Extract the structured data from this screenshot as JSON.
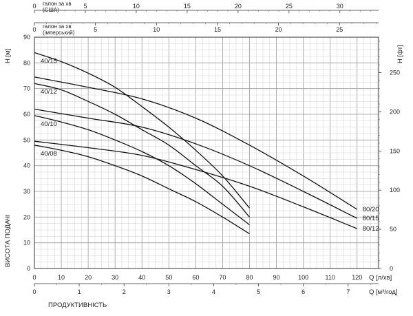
{
  "chart_data": {
    "type": "line",
    "grid": true,
    "axes": {
      "us_gallon": {
        "label": "галон за хв (США)",
        "lim": [
          0,
          33.8
        ],
        "ticks": [
          "0",
          "5",
          "10",
          "15",
          "20",
          "25",
          "30"
        ]
      },
      "imp_gallon": {
        "label": "галон за хв (імперський)",
        "lim": [
          0,
          28.2
        ],
        "ticks": [
          "0",
          "5",
          "10",
          "15",
          "20",
          "25"
        ]
      },
      "q_lmin": {
        "label": "Q [л/хв]",
        "lim": [
          0,
          128
        ],
        "ticks": [
          "0",
          "10",
          "20",
          "30",
          "40",
          "50",
          "60",
          "70",
          "80",
          "90",
          "100",
          "110",
          "120"
        ]
      },
      "q_m3h": {
        "label": "Q [м³/год]",
        "lim": [
          0,
          7.68
        ],
        "ticks": [
          "0",
          "1",
          "2",
          "3",
          "4",
          "5",
          "6",
          "7"
        ]
      },
      "h_m": {
        "label": "H [м]",
        "lim": [
          0,
          90
        ],
        "ticks": [
          "0",
          "10",
          "20",
          "30",
          "40",
          "50",
          "60",
          "70",
          "80",
          "90"
        ]
      },
      "h_ft": {
        "label": "H [фт]",
        "lim": [
          0,
          295.3
        ],
        "ticks": [
          "0",
          "50",
          "100",
          "150",
          "200",
          "250"
        ]
      }
    },
    "ylabel_bottom": "ВИСОТА ПОДАЧІ",
    "xlabel_bottom": "ПРОДУКТИВНІСТЬ",
    "series": [
      {
        "name": "40/08",
        "x": [
          0,
          10,
          20,
          30,
          40,
          50,
          60,
          70,
          80
        ],
        "y": [
          48,
          46,
          43.5,
          40,
          36,
          31,
          26,
          20,
          13.5
        ]
      },
      {
        "name": "40/10",
        "x": [
          0,
          10,
          20,
          30,
          40,
          50,
          60,
          70,
          80
        ],
        "y": [
          59.5,
          57,
          54,
          50,
          45.5,
          40,
          33,
          25,
          17
        ]
      },
      {
        "name": "40/12",
        "x": [
          0,
          10,
          20,
          30,
          40,
          50,
          60,
          70,
          80
        ],
        "y": [
          72,
          69.5,
          65,
          60,
          54,
          48,
          40,
          32,
          20
        ]
      },
      {
        "name": "40/15",
        "x": [
          0,
          10,
          20,
          30,
          40,
          50,
          60,
          70,
          80
        ],
        "y": [
          84,
          80.5,
          76,
          70.5,
          63,
          55,
          46,
          36,
          23.5
        ]
      },
      {
        "name": "80/12",
        "x": [
          0,
          20,
          40,
          60,
          80,
          100,
          120
        ],
        "y": [
          49.5,
          47,
          44,
          38.5,
          32,
          24,
          15.5
        ]
      },
      {
        "name": "80/15",
        "x": [
          0,
          20,
          40,
          60,
          80,
          100,
          120
        ],
        "y": [
          62,
          58.5,
          55,
          48.5,
          40,
          30,
          19.5
        ]
      },
      {
        "name": "80/20",
        "x": [
          0,
          20,
          40,
          60,
          80,
          100,
          120
        ],
        "y": [
          74.5,
          70.5,
          66,
          58.5,
          48,
          36,
          23
        ]
      }
    ]
  }
}
